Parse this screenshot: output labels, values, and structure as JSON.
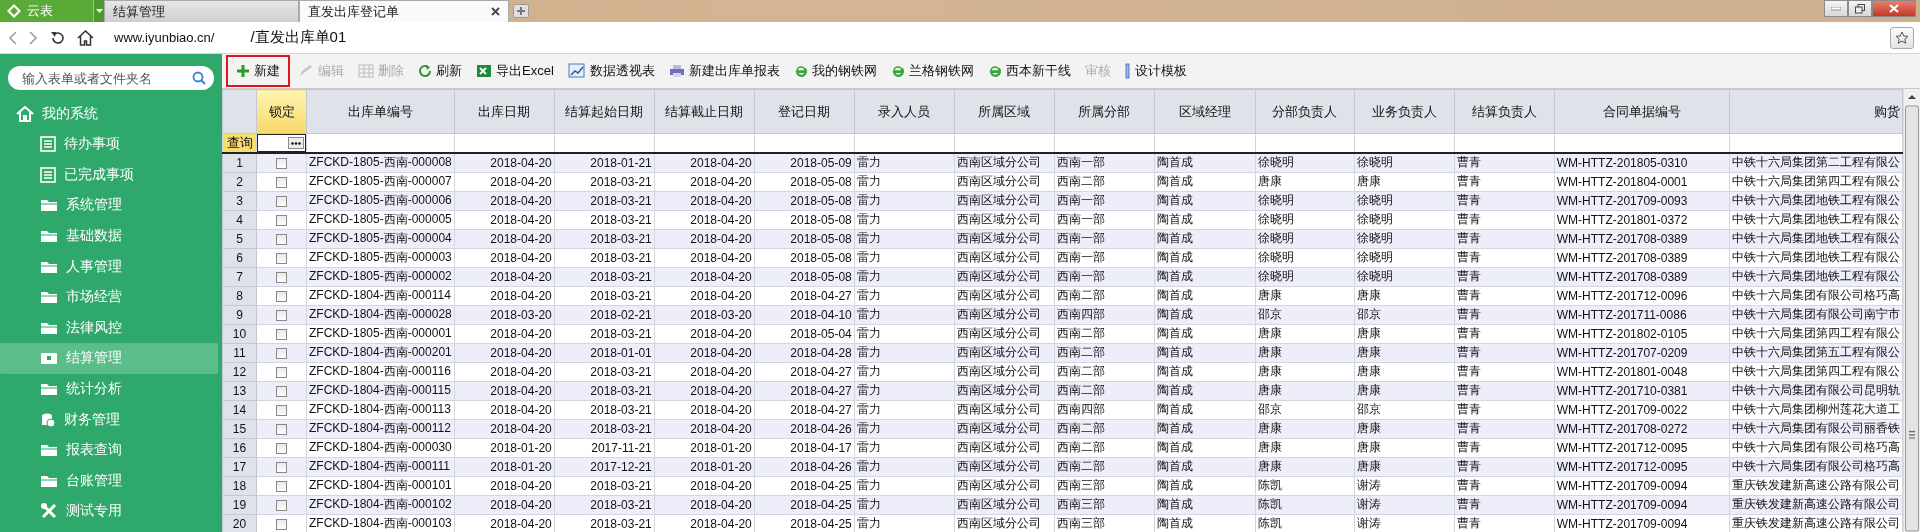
{
  "app_button": {
    "label": "云表"
  },
  "tabs": [
    {
      "label": "结算管理",
      "selected": false
    },
    {
      "label": "直发出库登记单",
      "selected": true
    }
  ],
  "address_bar": {
    "url": "www.iyunbiao.cn/",
    "path": "/直发出库单01"
  },
  "sidebar": {
    "search": {
      "placeholder": "输入表单或者文件夹名"
    },
    "title": "我的系统",
    "items": [
      {
        "label": "待办事项",
        "kind": "list",
        "selected": false
      },
      {
        "label": "已完成事项",
        "kind": "list",
        "selected": false
      },
      {
        "label": "系统管理",
        "kind": "folder",
        "selected": false
      },
      {
        "label": "基础数据",
        "kind": "folder",
        "selected": false
      },
      {
        "label": "人事管理",
        "kind": "folder",
        "selected": false
      },
      {
        "label": "市场经营",
        "kind": "folder",
        "selected": false
      },
      {
        "label": "法律风控",
        "kind": "folder",
        "selected": false
      },
      {
        "label": "结算管理",
        "kind": "card",
        "selected": true
      },
      {
        "label": "统计分析",
        "kind": "folder",
        "selected": false
      },
      {
        "label": "财务管理",
        "kind": "coins",
        "selected": false
      },
      {
        "label": "报表查询",
        "kind": "folder",
        "selected": false
      },
      {
        "label": "台账管理",
        "kind": "folder",
        "selected": false
      },
      {
        "label": "测试专用",
        "kind": "tools",
        "selected": false
      }
    ]
  },
  "toolbar": [
    {
      "label": "新建",
      "kind": "plus",
      "disabled": false,
      "highlighted": true
    },
    {
      "label": "编辑",
      "kind": "pencil",
      "disabled": true,
      "highlighted": false
    },
    {
      "label": "删除",
      "kind": "grid",
      "disabled": true,
      "highlighted": false
    },
    {
      "label": "刷新",
      "kind": "refresh",
      "disabled": false,
      "highlighted": false
    },
    {
      "label": "导出Excel",
      "kind": "excel",
      "disabled": false,
      "highlighted": false
    },
    {
      "label": "数据透视表",
      "kind": "pivot",
      "disabled": false,
      "highlighted": false
    },
    {
      "label": "新建出库单报表",
      "kind": "printer",
      "disabled": false,
      "highlighted": false
    },
    {
      "label": "我的钢铁网",
      "kind": "browser",
      "disabled": false,
      "highlighted": false
    },
    {
      "label": "兰格钢铁网",
      "kind": "browser",
      "disabled": false,
      "highlighted": false
    },
    {
      "label": "西本新干线",
      "kind": "browser",
      "disabled": false,
      "highlighted": false
    },
    {
      "label": "审核",
      "kind": "text",
      "disabled": true,
      "highlighted": false
    },
    {
      "label": "设计模板",
      "kind": "bar",
      "disabled": false,
      "highlighted": false
    }
  ],
  "table": {
    "query_label": "查询",
    "lock_column": {
      "label": "锁定",
      "selected": true
    },
    "columns": [
      {
        "label": "出库单编号",
        "selected": false
      },
      {
        "label": "出库日期",
        "selected": false
      },
      {
        "label": "结算起始日期",
        "selected": false
      },
      {
        "label": "结算截止日期",
        "selected": false
      },
      {
        "label": "登记日期",
        "selected": false
      },
      {
        "label": "录入人员",
        "selected": false
      },
      {
        "label": "所属区域",
        "selected": false
      },
      {
        "label": "所属分部",
        "selected": false
      },
      {
        "label": "区域经理",
        "selected": false
      },
      {
        "label": "分部负责人",
        "selected": false
      },
      {
        "label": "业务负责人",
        "selected": false
      },
      {
        "label": "结算负责人",
        "selected": false
      },
      {
        "label": "合同单据编号",
        "selected": false
      },
      {
        "label": "购货",
        "selected": false
      }
    ],
    "rows": [
      {
        "number": "1",
        "locked": false,
        "cells": [
          "ZFCKD-1805-西南-000008",
          "2018-04-20",
          "2018-01-21",
          "2018-04-20",
          "2018-05-09",
          "雷力",
          "西南区域分公司",
          "西南一部",
          "陶首成",
          "徐晓明",
          "徐晓明",
          "曹青",
          "WM-HTTZ-201805-0310",
          "中铁十六局集团第二工程有限公"
        ]
      },
      {
        "number": "2",
        "locked": false,
        "cells": [
          "ZFCKD-1805-西南-000007",
          "2018-04-20",
          "2018-03-21",
          "2018-04-20",
          "2018-05-08",
          "雷力",
          "西南区域分公司",
          "西南二部",
          "陶首成",
          "唐康",
          "唐康",
          "曹青",
          "WM-HTTZ-201804-0001",
          "中铁十六局集团第四工程有限公"
        ]
      },
      {
        "number": "3",
        "locked": false,
        "cells": [
          "ZFCKD-1805-西南-000006",
          "2018-04-20",
          "2018-03-21",
          "2018-04-20",
          "2018-05-08",
          "雷力",
          "西南区域分公司",
          "西南一部",
          "陶首成",
          "徐晓明",
          "徐晓明",
          "曹青",
          "WM-HTTZ-201709-0093",
          "中铁十六局集团地铁工程有限公"
        ]
      },
      {
        "number": "4",
        "locked": false,
        "cells": [
          "ZFCKD-1805-西南-000005",
          "2018-04-20",
          "2018-03-21",
          "2018-04-20",
          "2018-05-08",
          "雷力",
          "西南区域分公司",
          "西南一部",
          "陶首成",
          "徐晓明",
          "徐晓明",
          "曹青",
          "WM-HTTZ-201801-0372",
          "中铁十六局集团地铁工程有限公"
        ]
      },
      {
        "number": "5",
        "locked": false,
        "cells": [
          "ZFCKD-1805-西南-000004",
          "2018-04-20",
          "2018-03-21",
          "2018-04-20",
          "2018-05-08",
          "雷力",
          "西南区域分公司",
          "西南一部",
          "陶首成",
          "徐晓明",
          "徐晓明",
          "曹青",
          "WM-HTTZ-201708-0389",
          "中铁十六局集团地铁工程有限公"
        ]
      },
      {
        "number": "6",
        "locked": false,
        "cells": [
          "ZFCKD-1805-西南-000003",
          "2018-04-20",
          "2018-03-21",
          "2018-04-20",
          "2018-05-08",
          "雷力",
          "西南区域分公司",
          "西南一部",
          "陶首成",
          "徐晓明",
          "徐晓明",
          "曹青",
          "WM-HTTZ-201708-0389",
          "中铁十六局集团地铁工程有限公"
        ]
      },
      {
        "number": "7",
        "locked": false,
        "cells": [
          "ZFCKD-1805-西南-000002",
          "2018-04-20",
          "2018-03-21",
          "2018-04-20",
          "2018-05-08",
          "雷力",
          "西南区域分公司",
          "西南一部",
          "陶首成",
          "徐晓明",
          "徐晓明",
          "曹青",
          "WM-HTTZ-201708-0389",
          "中铁十六局集团地铁工程有限公"
        ]
      },
      {
        "number": "8",
        "locked": false,
        "cells": [
          "ZFCKD-1804-西南-000114",
          "2018-04-20",
          "2018-03-21",
          "2018-04-20",
          "2018-04-27",
          "雷力",
          "西南区域分公司",
          "西南二部",
          "陶首成",
          "唐康",
          "唐康",
          "曹青",
          "WM-HTTZ-201712-0096",
          "中铁十六局集团有限公司格巧高"
        ]
      },
      {
        "number": "9",
        "locked": false,
        "cells": [
          "ZFCKD-1804-西南-000028",
          "2018-03-20",
          "2018-02-21",
          "2018-03-20",
          "2018-04-10",
          "雷力",
          "西南区域分公司",
          "西南四部",
          "陶首成",
          "邵京",
          "邵京",
          "曹青",
          "WM-HTTZ-201711-0086",
          "中铁十六局集团有限公司南宁市"
        ]
      },
      {
        "number": "10",
        "locked": false,
        "cells": [
          "ZFCKD-1805-西南-000001",
          "2018-04-20",
          "2018-03-21",
          "2018-04-20",
          "2018-05-04",
          "雷力",
          "西南区域分公司",
          "西南二部",
          "陶首成",
          "唐康",
          "唐康",
          "曹青",
          "WM-HTTZ-201802-0105",
          "中铁十六局集团第四工程有限公"
        ]
      },
      {
        "number": "11",
        "locked": false,
        "cells": [
          "ZFCKD-1804-西南-000201",
          "2018-04-20",
          "2018-01-01",
          "2018-04-20",
          "2018-04-28",
          "雷力",
          "西南区域分公司",
          "西南二部",
          "陶首成",
          "唐康",
          "唐康",
          "曹青",
          "WM-HTTZ-201707-0209",
          "中铁十六局集团第五工程有限公"
        ]
      },
      {
        "number": "12",
        "locked": false,
        "cells": [
          "ZFCKD-1804-西南-000116",
          "2018-04-20",
          "2018-03-21",
          "2018-04-20",
          "2018-04-27",
          "雷力",
          "西南区域分公司",
          "西南二部",
          "陶首成",
          "唐康",
          "唐康",
          "曹青",
          "WM-HTTZ-201801-0048",
          "中铁十六局集团第四工程有限公"
        ]
      },
      {
        "number": "13",
        "locked": false,
        "cells": [
          "ZFCKD-1804-西南-000115",
          "2018-04-20",
          "2018-03-21",
          "2018-04-20",
          "2018-04-27",
          "雷力",
          "西南区域分公司",
          "西南二部",
          "陶首成",
          "唐康",
          "唐康",
          "曹青",
          "WM-HTTZ-201710-0381",
          "中铁十六局集团有限公司昆明轨"
        ]
      },
      {
        "number": "14",
        "locked": false,
        "cells": [
          "ZFCKD-1804-西南-000113",
          "2018-04-20",
          "2018-03-21",
          "2018-04-20",
          "2018-04-27",
          "雷力",
          "西南区域分公司",
          "西南四部",
          "陶首成",
          "邵京",
          "邵京",
          "曹青",
          "WM-HTTZ-201709-0022",
          "中铁十六局集团柳州莲花大道工"
        ]
      },
      {
        "number": "15",
        "locked": false,
        "cells": [
          "ZFCKD-1804-西南-000112",
          "2018-04-20",
          "2018-03-21",
          "2018-04-20",
          "2018-04-26",
          "雷力",
          "西南区域分公司",
          "西南二部",
          "陶首成",
          "唐康",
          "唐康",
          "曹青",
          "WM-HTTZ-201708-0272",
          "中铁十六局集团有限公司丽香铁"
        ]
      },
      {
        "number": "16",
        "locked": false,
        "cells": [
          "ZFCKD-1804-西南-000030",
          "2018-01-20",
          "2017-11-21",
          "2018-01-20",
          "2018-04-17",
          "雷力",
          "西南区域分公司",
          "西南二部",
          "陶首成",
          "唐康",
          "唐康",
          "曹青",
          "WM-HTTZ-201712-0095",
          "中铁十六局集团有限公司格巧高"
        ]
      },
      {
        "number": "17",
        "locked": false,
        "cells": [
          "ZFCKD-1804-西南-000111",
          "2018-01-20",
          "2017-12-21",
          "2018-01-20",
          "2018-04-26",
          "雷力",
          "西南区域分公司",
          "西南二部",
          "陶首成",
          "唐康",
          "唐康",
          "曹青",
          "WM-HTTZ-201712-0095",
          "中铁十六局集团有限公司格巧高"
        ]
      },
      {
        "number": "18",
        "locked": false,
        "cells": [
          "ZFCKD-1804-西南-000101",
          "2018-04-20",
          "2018-03-21",
          "2018-04-20",
          "2018-04-25",
          "雷力",
          "西南区域分公司",
          "西南三部",
          "陶首成",
          "陈凯",
          "谢涛",
          "曹青",
          "WM-HTTZ-201709-0094",
          "重庆铁发建新高速公路有限公司"
        ]
      },
      {
        "number": "19",
        "locked": false,
        "cells": [
          "ZFCKD-1804-西南-000102",
          "2018-04-20",
          "2018-03-21",
          "2018-04-20",
          "2018-04-25",
          "雷力",
          "西南区域分公司",
          "西南三部",
          "陶首成",
          "陈凯",
          "谢涛",
          "曹青",
          "WM-HTTZ-201709-0094",
          "重庆铁发建新高速公路有限公司"
        ]
      },
      {
        "number": "20",
        "locked": false,
        "cells": [
          "ZFCKD-1804-西南-000103",
          "2018-04-20",
          "2018-03-21",
          "2018-04-20",
          "2018-04-25",
          "雷力",
          "西南区域分公司",
          "西南三部",
          "陶首成",
          "陈凯",
          "谢涛",
          "曹青",
          "WM-HTTZ-201709-0094",
          "重庆铁发建新高速公路有限公司"
        ]
      }
    ]
  }
}
